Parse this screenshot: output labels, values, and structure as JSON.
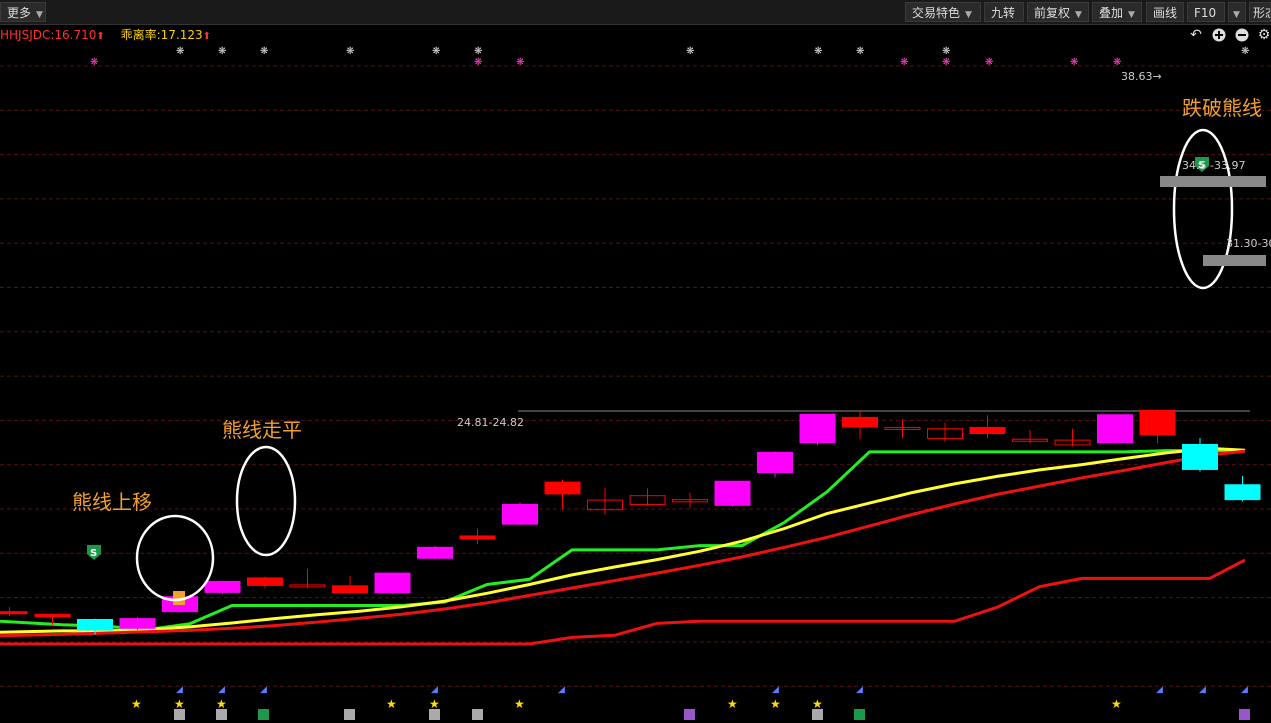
{
  "toolbar": {
    "more_label": "更多",
    "buttons": [
      "交易特色",
      "九转",
      "前复权",
      "叠加",
      "画线",
      "F10",
      "形态"
    ]
  },
  "indicator": {
    "a_label": "HHJSJDC:16.710",
    "b_label": "乖离率:17.123"
  },
  "tool_icons": [
    "back-icon",
    "zoom-in-icon",
    "zoom-out-icon",
    "settings-icon"
  ],
  "colors": {
    "up": "#ff0000",
    "magenta": "#ff00ff",
    "cyan": "#00ffff",
    "green_line": "#22ee22",
    "yellow_line": "#ffff33",
    "red_line": "#ee1111",
    "annotation": "#f0a030",
    "grid": "#5a1010"
  },
  "annotations": {
    "up_move": "熊线上移",
    "flat": "熊线走平",
    "break": "跌破熊线"
  },
  "price_labels": {
    "high": "38.63→",
    "mid_range": "24.81-24.82",
    "resist": "34.5",
    "resist_right": "-33.97",
    "support": "31.30-30.",
    "s_marker": "S"
  },
  "chart_data": {
    "type": "candlestick",
    "title": "",
    "candles": [
      {
        "o": 20.0,
        "c": 19.5,
        "h": 21.0,
        "l": 19.0,
        "color": "red"
      },
      {
        "o": 19.4,
        "c": 18.8,
        "h": 19.6,
        "l": 17.0,
        "color": "red"
      },
      {
        "o": 18.2,
        "c": 15.8,
        "h": 18.4,
        "l": 14.7,
        "color": "cyan"
      },
      {
        "o": 16.2,
        "c": 18.4,
        "h": 18.8,
        "l": 15.8,
        "color": "magenta"
      },
      {
        "o": 20.0,
        "c": 23.4,
        "h": 23.6,
        "l": 19.8,
        "color": "magenta"
      },
      {
        "o": 24.4,
        "c": 26.9,
        "h": 27.1,
        "l": 24.0,
        "color": "magenta"
      },
      {
        "o": 27.7,
        "c": 26.0,
        "h": 28.0,
        "l": 25.3,
        "color": "red"
      },
      {
        "o": 26.0,
        "c": 26.1,
        "h": 29.8,
        "l": 25.3,
        "color": "red-doji"
      },
      {
        "o": 25.9,
        "c": 24.3,
        "h": 28.2,
        "l": 24.0,
        "color": "red"
      },
      {
        "o": 24.3,
        "c": 28.8,
        "h": 28.9,
        "l": 24.0,
        "color": "magenta"
      },
      {
        "o": 32.2,
        "c": 34.7,
        "h": 35.0,
        "l": 32.0,
        "color": "magenta"
      },
      {
        "o": 37.3,
        "c": 36.6,
        "h": 39.0,
        "l": 35.4,
        "color": "red"
      },
      {
        "o": 40.0,
        "c": 44.5,
        "h": 45.0,
        "l": 39.8,
        "color": "magenta"
      },
      {
        "o": 49.6,
        "c": 46.9,
        "h": 50.2,
        "l": 43.3,
        "color": "red"
      },
      {
        "o": 43.3,
        "c": 45.5,
        "h": 48.2,
        "l": 42.2,
        "color": "red-hollow"
      },
      {
        "o": 44.5,
        "c": 46.5,
        "h": 48.2,
        "l": 44.2,
        "color": "red-hollow"
      },
      {
        "o": 45.1,
        "c": 45.6,
        "h": 47.2,
        "l": 43.8,
        "color": "red-hollow"
      },
      {
        "o": 44.3,
        "c": 49.8,
        "h": 49.9,
        "l": 44.0,
        "color": "magenta"
      },
      {
        "o": 51.8,
        "c": 56.4,
        "h": 56.6,
        "l": 50.7,
        "color": "magenta"
      },
      {
        "o": 58.6,
        "c": 65.1,
        "h": 65.2,
        "l": 58.0,
        "color": "magenta"
      },
      {
        "o": 64.4,
        "c": 62.2,
        "h": 65.7,
        "l": 59.4,
        "color": "red"
      },
      {
        "o": 61.7,
        "c": 62.1,
        "h": 64.0,
        "l": 59.7,
        "color": "red-doji"
      },
      {
        "o": 59.6,
        "c": 61.8,
        "h": 63.2,
        "l": 58.8,
        "color": "red-hollow"
      },
      {
        "o": 62.1,
        "c": 60.7,
        "h": 64.9,
        "l": 59.7,
        "color": "red"
      },
      {
        "o": 59.2,
        "c": 59.4,
        "h": 61.5,
        "l": 58.4,
        "color": "red-doji"
      },
      {
        "o": 58.1,
        "c": 59.2,
        "h": 61.8,
        "l": 57.8,
        "color": "red-hollow"
      },
      {
        "o": 58.6,
        "c": 65.0,
        "h": 65.1,
        "l": 58.4,
        "color": "magenta"
      },
      {
        "o": 66.0,
        "c": 60.4,
        "h": 66.2,
        "l": 58.5,
        "color": "red"
      },
      {
        "o": 58.2,
        "c": 52.5,
        "h": 59.7,
        "l": 52.0,
        "color": "cyan"
      },
      {
        "o": 49.0,
        "c": 45.6,
        "h": 51.0,
        "l": 45.2,
        "color": "cyan"
      }
    ],
    "series": [
      {
        "color": "green",
        "values": [
          17.8,
          17.0,
          16.7,
          15.9,
          17.2,
          21.4,
          21.4,
          21.4,
          21.4,
          21.4,
          22.2,
          26.2,
          27.4,
          34.1,
          34.1,
          34.1,
          35.1,
          35.1,
          40.4,
          47.4,
          56.5,
          56.5,
          56.5,
          56.5,
          56.5,
          56.5,
          56.5,
          56.8,
          56.8,
          56.8
        ]
      },
      {
        "color": "yellow",
        "values": [
          15.3,
          15.6,
          15.6,
          15.9,
          16.5,
          17.4,
          18.4,
          19.3,
          20.1,
          21.1,
          22.4,
          24.2,
          26.2,
          28.4,
          30.2,
          31.9,
          33.8,
          36.1,
          39.0,
          42.4,
          44.8,
          47.2,
          49.2,
          50.9,
          52.4,
          53.6,
          55.0,
          56.3,
          57.3,
          56.9
        ]
      },
      {
        "color": "red",
        "values": [
          14.5,
          14.8,
          15.1,
          15.4,
          15.7,
          16.2,
          16.8,
          17.6,
          18.5,
          19.4,
          20.6,
          22.0,
          23.7,
          25.4,
          27.1,
          28.8,
          30.6,
          32.5,
          34.7,
          37.0,
          39.6,
          42.2,
          44.6,
          46.8,
          48.7,
          50.6,
          52.3,
          54.1,
          55.8,
          56.7
        ]
      },
      {
        "color": "red-lower",
        "values": [
          12.6,
          12.6,
          12.6,
          12.6,
          12.6,
          12.6,
          12.6,
          12.6,
          12.6,
          12.6,
          12.6,
          12.6,
          12.6,
          14.1,
          14.6,
          17.3,
          17.8,
          17.8,
          17.8,
          17.8,
          17.8,
          17.8,
          17.8,
          21.0,
          25.7,
          27.6,
          27.6,
          27.6,
          27.6,
          31.8
        ]
      }
    ]
  }
}
